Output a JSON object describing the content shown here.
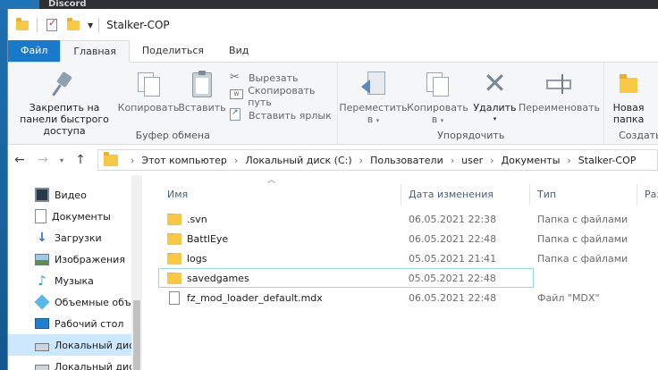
{
  "background": {
    "discord_title": "Discord"
  },
  "window": {
    "title": "Stalker-COP"
  },
  "tabs": [
    {
      "label": "Файл"
    },
    {
      "label": "Главная"
    },
    {
      "label": "Поделиться"
    },
    {
      "label": "Вид"
    }
  ],
  "ribbon": {
    "clipboard": {
      "group_label": "Буфер обмена",
      "pin_label": "Закрепить на панели быстрого доступа",
      "copy_label": "Копировать",
      "paste_label": "Вставить",
      "cut_label": "Вырезать",
      "copy_path_label": "Скопировать путь",
      "paste_shortcut_label": "Вставить ярлык"
    },
    "organize": {
      "group_label": "Упорядочить",
      "move_label": "Переместить в",
      "copy_to_label": "Копировать в",
      "delete_label": "Удалить",
      "rename_label": "Переименовать"
    },
    "create": {
      "group_label": "Создать",
      "new_folder_label": "Новая папка"
    }
  },
  "address": {
    "crumbs": [
      "Этот компьютер",
      "Локальный диск (C:)",
      "Пользователи",
      "user",
      "Документы",
      "Stalker-COP"
    ]
  },
  "navpane": {
    "items": [
      {
        "label": "Видео",
        "icon": "video-icon"
      },
      {
        "label": "Документы",
        "icon": "documents-icon"
      },
      {
        "label": "Загрузки",
        "icon": "downloads-icon"
      },
      {
        "label": "Изображения",
        "icon": "images-icon"
      },
      {
        "label": "Музыка",
        "icon": "music-icon"
      },
      {
        "label": "Объемные объекты",
        "icon": "3d-objects-icon"
      },
      {
        "label": "Рабочий стол",
        "icon": "desktop-icon"
      },
      {
        "label": "Локальный диск (C:)",
        "icon": "drive-icon"
      },
      {
        "label": "Локальный диск (D:)",
        "icon": "drive-icon"
      }
    ]
  },
  "columns": {
    "name": "Имя",
    "date": "Дата изменения",
    "type": "Тип",
    "size": "Размер"
  },
  "files": [
    {
      "name": ".svn",
      "date": "06.05.2021 22:38",
      "type": "Папка с файлами",
      "kind": "folder"
    },
    {
      "name": "BattlEye",
      "date": "06.05.2021 22:48",
      "type": "Папка с файлами",
      "kind": "folder"
    },
    {
      "name": "logs",
      "date": "05.05.2021 21:41",
      "type": "Папка с файлами",
      "kind": "folder"
    },
    {
      "name": "savedgames",
      "date": "05.05.2021 22:48",
      "type": "Папка с файлами",
      "kind": "folder"
    },
    {
      "name": "fz_mod_loader_default.mdx",
      "date": "06.05.2021 22:48",
      "type": "Файл \"MDX\"",
      "kind": "file"
    }
  ]
}
